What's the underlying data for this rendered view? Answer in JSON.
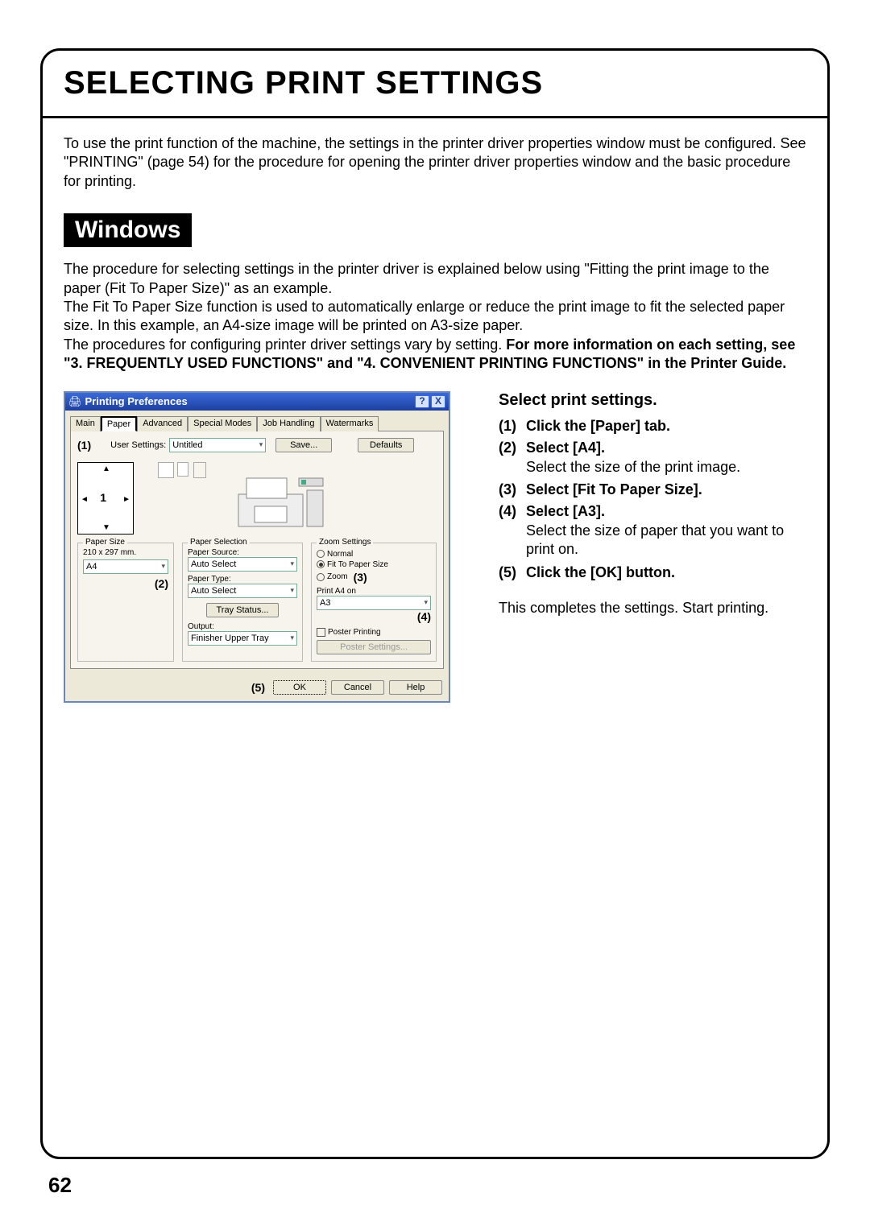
{
  "page": {
    "title": "SELECTING PRINT SETTINGS",
    "number": "62"
  },
  "intro": "To use the print function of the machine, the settings in the printer driver properties window must be configured. See \"PRINTING\" (page 54) for the procedure for opening the printer driver properties window and the basic procedure for printing.",
  "os_label": "Windows",
  "procedure": {
    "p1": "The procedure for selecting settings in the printer driver is explained below using \"Fitting the print image to the paper (Fit To Paper Size)\" as an example.",
    "p2": "The Fit To Paper Size function is used to automatically enlarge or reduce the print image to fit the selected paper size. In this example, an A4-size image will be printed on A3-size paper.",
    "p3a": "The procedures for configuring printer driver settings vary by setting. ",
    "p3b": "For more information on each setting, see \"3. FREQUENTLY USED FUNCTIONS\" and \"4. CONVENIENT PRINTING FUNCTIONS\" in the Printer Guide."
  },
  "dialog": {
    "title": "Printing Preferences",
    "help_btn": "?",
    "close_btn": "X",
    "tabs": {
      "main": "Main",
      "paper": "Paper",
      "advanced": "Advanced",
      "special": "Special Modes",
      "job": "Job Handling",
      "water": "Watermarks"
    },
    "user_settings_label": "User Settings:",
    "user_settings_value": "Untitled",
    "save_btn": "Save...",
    "defaults_btn": "Defaults",
    "markers": {
      "m1": "(1)",
      "m2": "(2)",
      "m3": "(3)",
      "m4": "(4)",
      "m5": "(5)"
    },
    "sheet_num": "1",
    "group_paper_size": {
      "legend": "Paper Size",
      "dim": "210 x 297 mm.",
      "value": "A4"
    },
    "group_selection": {
      "legend": "Paper Selection",
      "source_label": "Paper Source:",
      "source_value": "Auto Select",
      "type_label": "Paper Type:",
      "type_value": "Auto Select",
      "tray_btn": "Tray Status...",
      "output_label": "Output:",
      "output_value": "Finisher Upper Tray"
    },
    "group_zoom": {
      "legend": "Zoom Settings",
      "normal": "Normal",
      "fit": "Fit To Paper Size",
      "zoom": "Zoom",
      "print_on": "Print A4 on",
      "print_on_value": "A3",
      "poster": "Poster Printing",
      "poster_btn": "Poster Settings..."
    },
    "footer": {
      "ok": "OK",
      "cancel": "Cancel",
      "help": "Help"
    }
  },
  "steps": {
    "title": "Select print settings.",
    "s1": {
      "n": "(1)",
      "t": "Click the [Paper] tab."
    },
    "s2": {
      "n": "(2)",
      "t": "Select [A4].",
      "note": "Select the size of the print image."
    },
    "s3": {
      "n": "(3)",
      "t": "Select [Fit To Paper Size]."
    },
    "s4": {
      "n": "(4)",
      "t": "Select [A3].",
      "note": "Select the size of paper that you want to print on."
    },
    "s5": {
      "n": "(5)",
      "t": "Click the [OK] button."
    },
    "closing": "This completes the settings. Start printing."
  }
}
